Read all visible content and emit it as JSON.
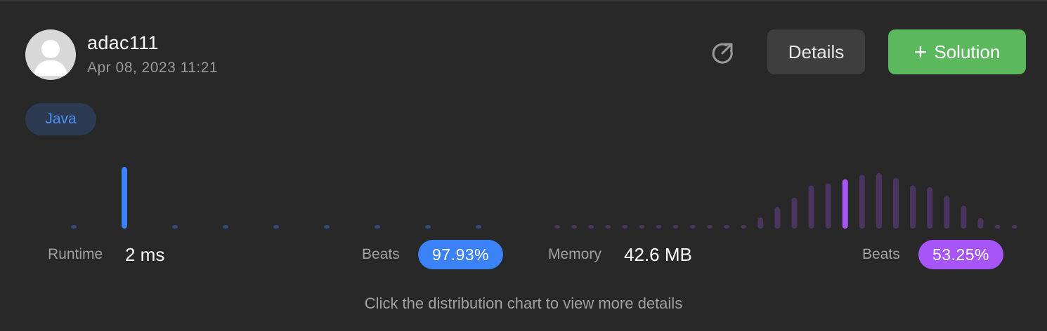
{
  "user": {
    "name": "adac111",
    "timestamp": "Apr 08, 2023 11:21"
  },
  "actions": {
    "details_label": "Details",
    "solution_label": "Solution",
    "share_icon": "share-icon"
  },
  "language_tag": "Java",
  "stats": {
    "runtime_label": "Runtime",
    "runtime_value": "2 ms",
    "runtime_beats_label": "Beats",
    "runtime_beats_value": "97.93%",
    "memory_label": "Memory",
    "memory_value": "42.6 MB",
    "memory_beats_label": "Beats",
    "memory_beats_value": "53.25%"
  },
  "hint": "Click the distribution chart to view more details",
  "colors": {
    "runtime_accent": "#3b82f6",
    "runtime_bar": "#2d4d7a",
    "memory_accent": "#a855f7",
    "memory_bar": "#4b3560",
    "solution_button": "#5cb85c"
  },
  "chart_data": [
    {
      "type": "bar",
      "name": "runtime-distribution",
      "values": [
        0.02,
        1.0,
        0.02,
        0.02,
        0.02,
        0.02,
        0.02,
        0.02,
        0.02
      ],
      "highlight_index": 1
    },
    {
      "type": "bar",
      "name": "memory-distribution",
      "values": [
        0.02,
        0.02,
        0.02,
        0.02,
        0.02,
        0.02,
        0.02,
        0.02,
        0.02,
        0.02,
        0.02,
        0.02,
        0.18,
        0.35,
        0.5,
        0.7,
        0.73,
        0.8,
        0.87,
        0.9,
        0.82,
        0.7,
        0.67,
        0.53,
        0.37,
        0.17,
        0.06,
        0.05
      ],
      "highlight_index": 17
    }
  ]
}
